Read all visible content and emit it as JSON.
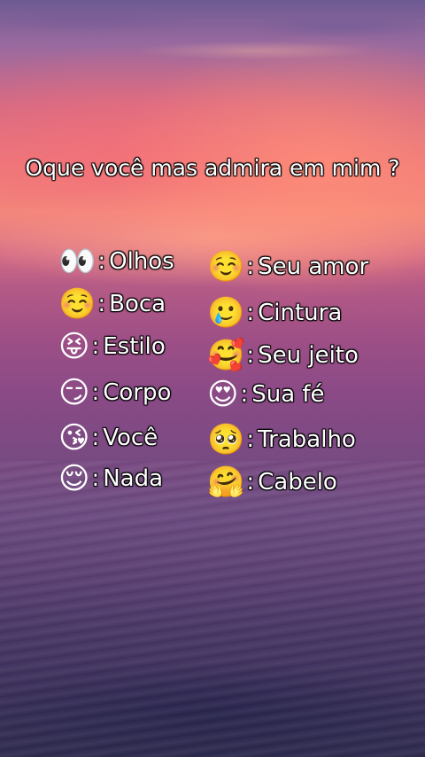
{
  "title": "Oque você mas admira em mim ?",
  "left_items": [
    {
      "emoji": "👀",
      "label": "Olhos"
    },
    {
      "emoji": "☺️",
      "label": "Boca"
    },
    {
      "emoji": "😝",
      "label": "Estilo"
    },
    {
      "emoji": "😏",
      "label": "Corpo"
    },
    {
      "emoji": "😘",
      "label": "Você"
    },
    {
      "emoji": "😌",
      "label": "Nada"
    }
  ],
  "right_items": [
    {
      "emoji": "☺️",
      "label": "Seu amor"
    },
    {
      "emoji": "🥲",
      "label": "Cintura"
    },
    {
      "emoji": "🥰",
      "label": "Seu jeito"
    },
    {
      "emoji": "😍",
      "label": "Sua fé"
    },
    {
      "emoji": "🥺",
      "label": "Trabalho"
    },
    {
      "emoji": "🤗",
      "label": "Cabelo"
    }
  ],
  "separator": ":"
}
